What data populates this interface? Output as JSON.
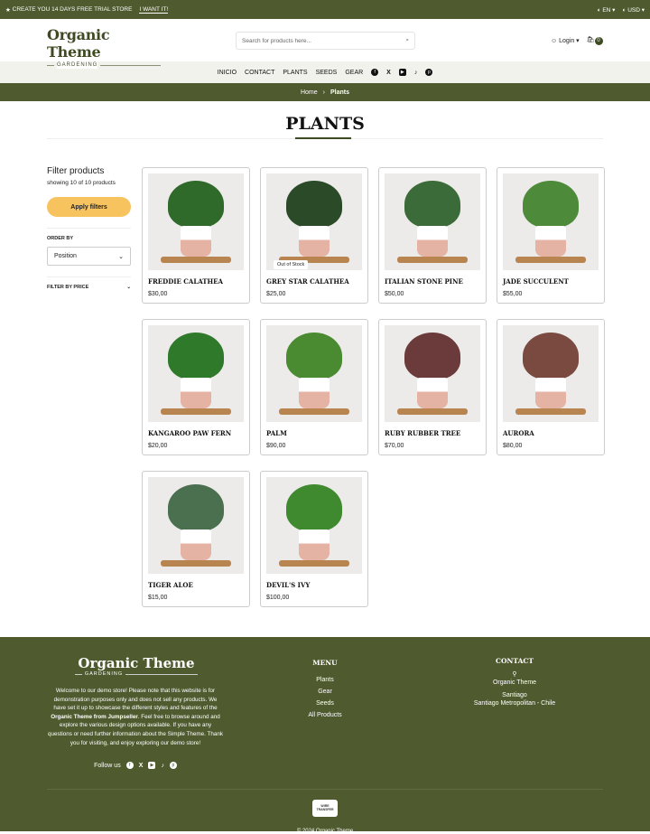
{
  "topbar": {
    "promo": "CREATE YOU 14 DAYS FREE TRIAL STORE",
    "cta": "I WANT IT!",
    "language": "EN",
    "currency": "USD"
  },
  "header": {
    "logo_title": "Organic Theme",
    "logo_subtitle": "GARDENING",
    "search_placeholder": "Search for products here...",
    "login": "Login",
    "cart_count": "0"
  },
  "nav": {
    "items": [
      "INICIO",
      "CONTACT",
      "PLANTS",
      "SEEDS",
      "GEAR"
    ],
    "social": [
      "facebook-icon",
      "x-icon",
      "youtube-icon",
      "tiktok-icon",
      "pinterest-icon"
    ]
  },
  "breadcrumb": {
    "home": "Home",
    "current": "Plants"
  },
  "page_title": "PLANTS",
  "sidebar": {
    "title": "Filter products",
    "count": "showing 10 of 10 products",
    "apply": "Apply filters",
    "order_label": "ORDER BY",
    "order_value": "Position",
    "price_label": "FILTER BY PRICE"
  },
  "products": [
    {
      "name": "FREDDIE CALATHEA",
      "price": "$30,00",
      "badge": ""
    },
    {
      "name": "GREY STAR CALATHEA",
      "price": "$25,00",
      "badge": "Out of Stock"
    },
    {
      "name": "ITALIAN STONE PINE",
      "price": "$50,00",
      "badge": ""
    },
    {
      "name": "JADE SUCCULENT",
      "price": "$55,00",
      "badge": ""
    },
    {
      "name": "KANGAROO PAW FERN",
      "price": "$20,00",
      "badge": ""
    },
    {
      "name": "PALM",
      "price": "$90,00",
      "badge": ""
    },
    {
      "name": "RUBY RUBBER TREE",
      "price": "$70,00",
      "badge": ""
    },
    {
      "name": "AURORA",
      "price": "$80,00",
      "badge": ""
    },
    {
      "name": "TIGER ALOE",
      "price": "$15,00",
      "badge": ""
    },
    {
      "name": "DEVIL'S IVY",
      "price": "$100,00",
      "badge": ""
    }
  ],
  "footer": {
    "logo_title": "Organic Theme",
    "logo_subtitle": "GARDENING",
    "desc_1": "Welcome to our demo store! Please note that this website is for demonstration purposes only and does not sell any products. We have set it up to showcase the different styles and features of the ",
    "desc_bold": "Organic Theme from Jumpseller",
    "desc_2": ". Feel free to browse around and explore the various design options available. If you have any questions or need further information about the Simple Theme. Thank you for visiting, and enjoy exploring our demo store!",
    "follow": "Follow us",
    "menu_title": "MENU",
    "menu": [
      "Plants",
      "Gear",
      "Seeds",
      "All Products"
    ],
    "contact_title": "CONTACT",
    "contact_name": "Organic Theme",
    "contact_city": "Santiago",
    "contact_region": "Santiago Metropolitan - Chile",
    "payment": "WIRE TRANSFER",
    "copyright": "© 2024 Organic Theme"
  },
  "colors": {
    "brand_green": "#4f5a2f",
    "accent_yellow": "#f7c35f"
  }
}
